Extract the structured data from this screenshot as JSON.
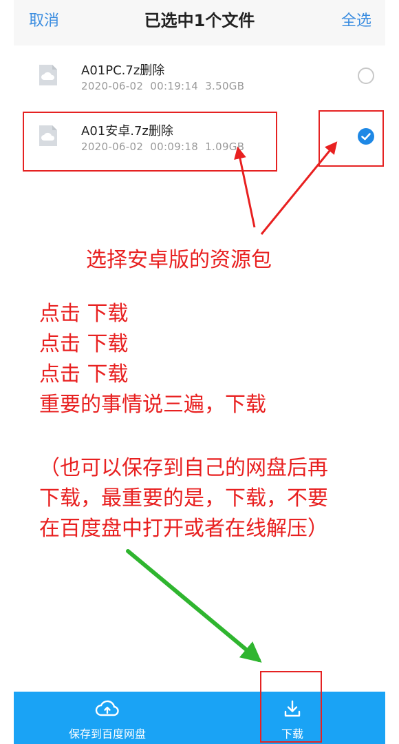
{
  "header": {
    "cancel_label": "取消",
    "title": "已选中1个文件",
    "select_all_label": "全选"
  },
  "files": [
    {
      "name": "A01PC.7z删除",
      "meta": "2020-06-02  00:19:14  3.50GB",
      "selected": false
    },
    {
      "name": "A01安卓.7z删除",
      "meta": "2020-06-02  00:09:18  1.09GB",
      "selected": true
    }
  ],
  "annotations": {
    "select_android": "选择安卓版的资源包",
    "click_download_lines": [
      "点击  下载",
      "点击  下载",
      "点击  下载",
      "重要的事情说三遍，下载"
    ],
    "note_lines": [
      "（也可以保存到自己的网盘后再",
      "下载，最重要的是，下载，不要",
      "在百度盘中打开或者在线解压）"
    ]
  },
  "bottom_bar": {
    "save_label": "保存到百度网盘",
    "download_label": "下载"
  },
  "colors": {
    "accent": "#1aa3f5",
    "header_text": "#3b8de0",
    "annotation_red": "#e82020",
    "arrow_green": "#2fb52f"
  },
  "icons": {
    "file": "cloud-file-icon",
    "save": "cloud-upload-icon",
    "download": "download-icon",
    "check": "check-icon"
  }
}
